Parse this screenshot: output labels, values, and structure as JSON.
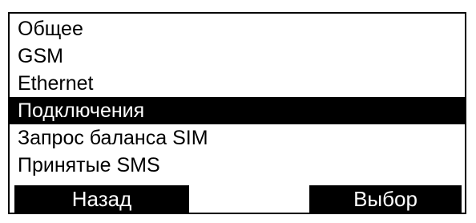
{
  "menu": {
    "items": [
      {
        "label": "Общее",
        "selected": false
      },
      {
        "label": "GSM",
        "selected": false
      },
      {
        "label": "Ethernet",
        "selected": false
      },
      {
        "label": "Подключения",
        "selected": true
      },
      {
        "label": "Запрос баланса SIM",
        "selected": false
      },
      {
        "label": "Принятые SMS",
        "selected": false
      }
    ]
  },
  "softkeys": {
    "left_label": "Назад",
    "right_label": "Выбор"
  },
  "colors": {
    "background": "#ffffff",
    "foreground": "#000000",
    "highlight": "#000000"
  }
}
